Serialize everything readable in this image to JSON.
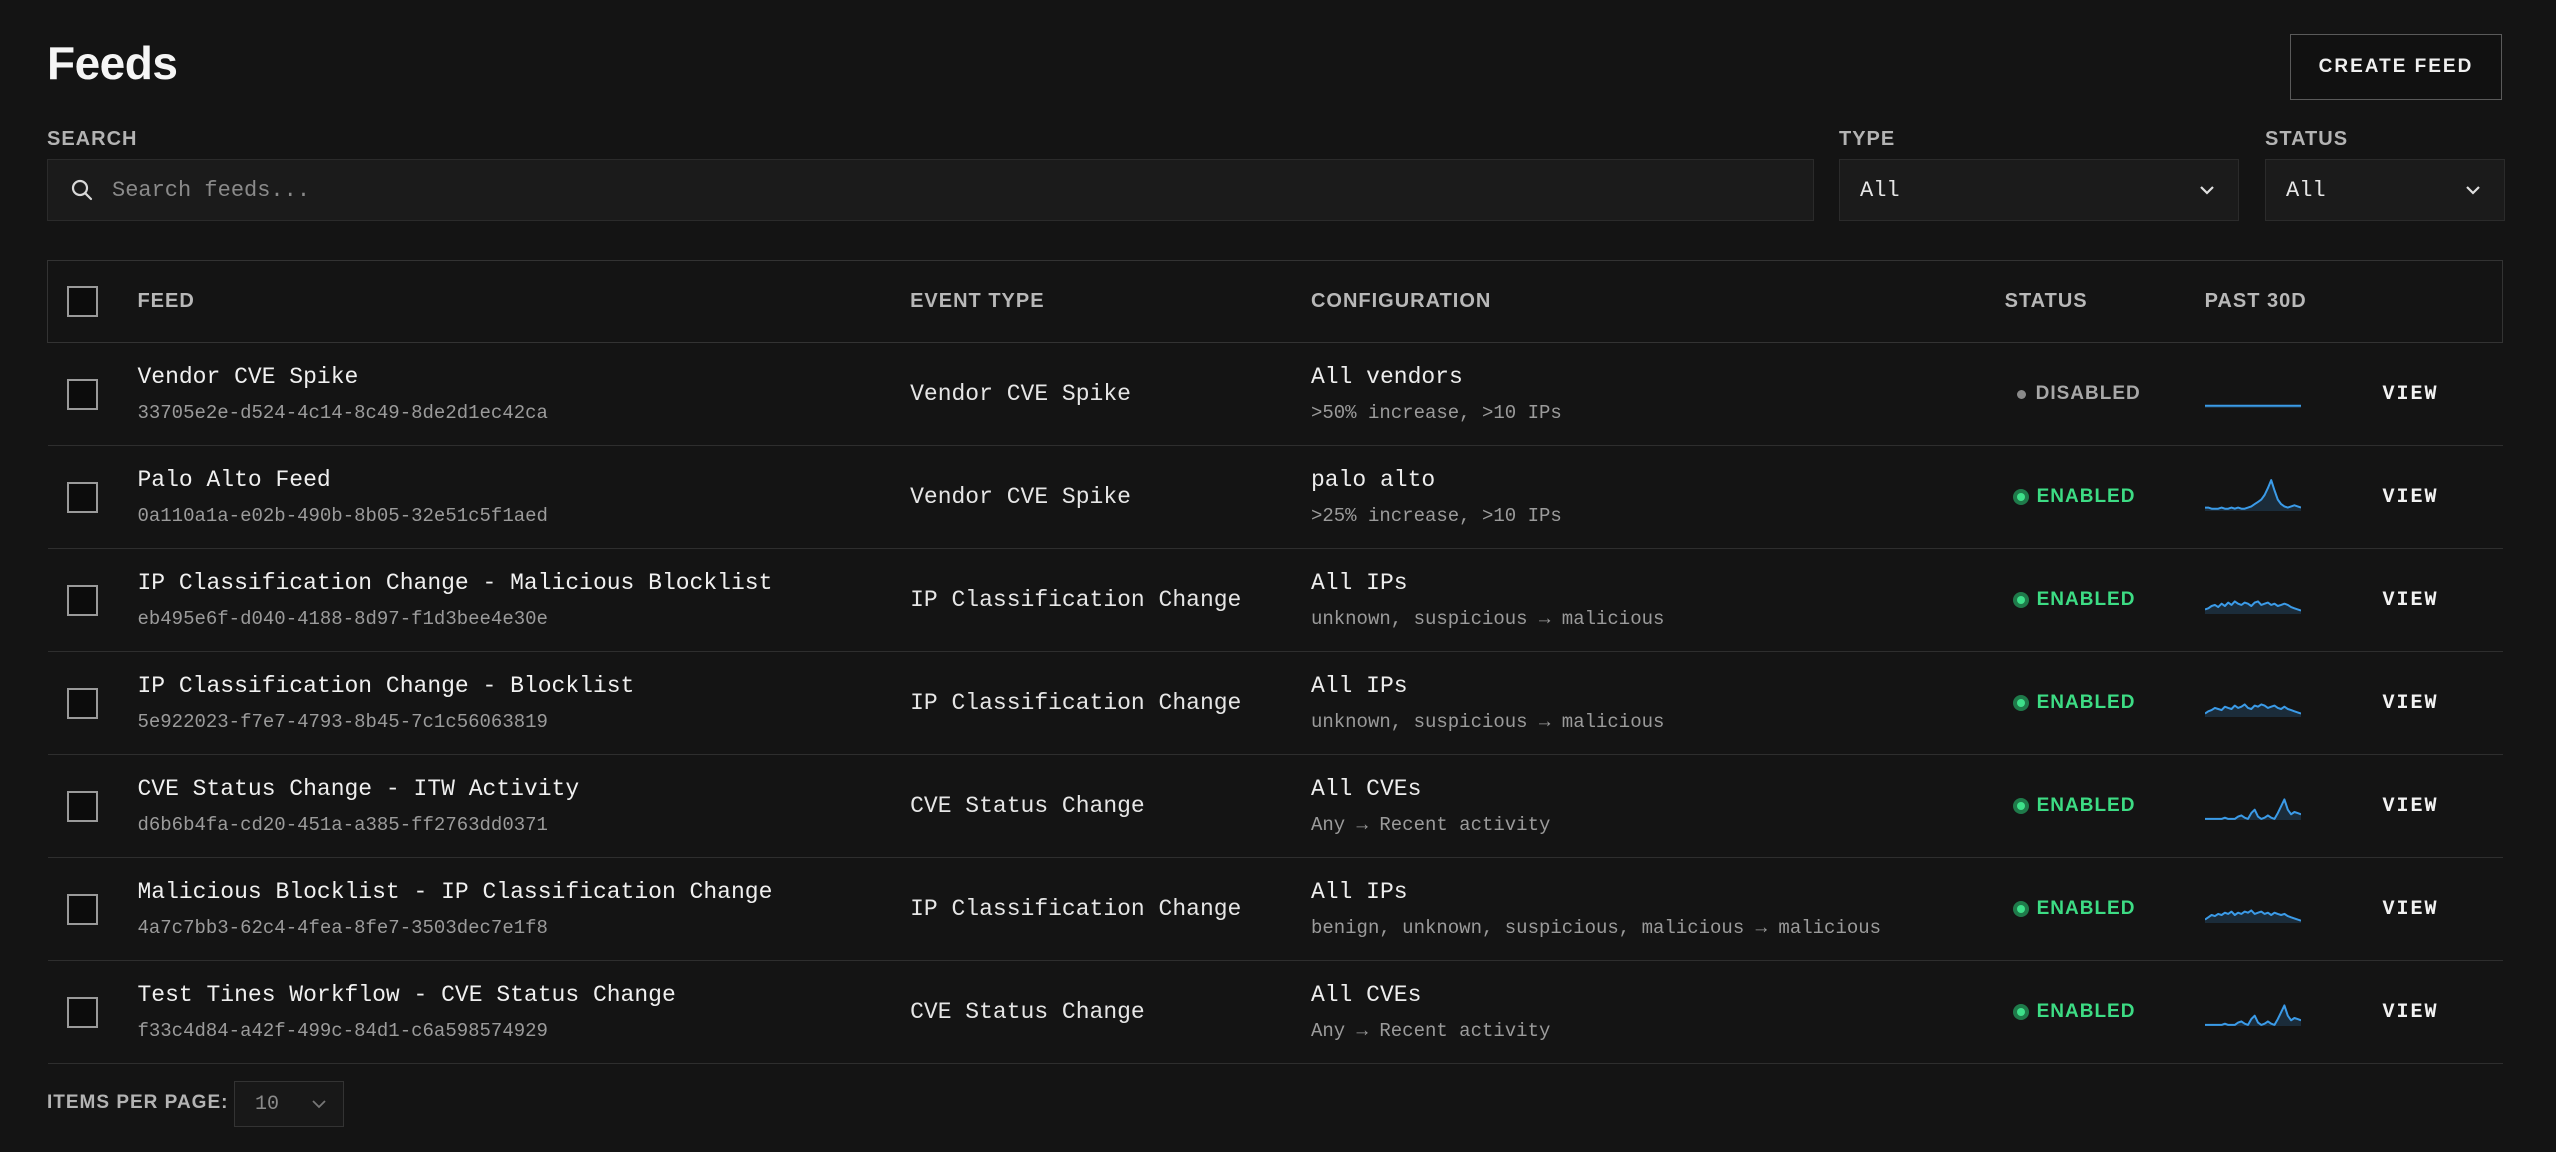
{
  "page": {
    "title": "Feeds",
    "create_label": "CREATE FEED"
  },
  "filters": {
    "search_label": "SEARCH",
    "search_placeholder": "Search feeds...",
    "type_label": "TYPE",
    "type_value": "All",
    "status_label": "STATUS",
    "status_value": "All"
  },
  "table": {
    "columns": [
      "FEED",
      "EVENT TYPE",
      "CONFIGURATION",
      "STATUS",
      "PAST 30D"
    ],
    "rows": [
      {
        "name": "Vendor CVE Spike",
        "id": "33705e2e-d524-4c14-8c49-8de2d1ec42ca",
        "event_type": "Vendor CVE Spike",
        "config_main": "All vendors",
        "config_sub": ">50% increase, >10 IPs",
        "status": "DISABLED",
        "action": "VIEW"
      },
      {
        "name": "Palo Alto Feed",
        "id": "0a110a1a-e02b-490b-8b05-32e51c5f1aed",
        "event_type": "Vendor CVE Spike",
        "config_main": "palo alto",
        "config_sub": ">25% increase, >10 IPs",
        "status": "ENABLED",
        "action": "VIEW"
      },
      {
        "name": "IP Classification Change - Malicious Blocklist",
        "id": "eb495e6f-d040-4188-8d97-f1d3bee4e30e",
        "event_type": "IP Classification Change",
        "config_main": "All IPs",
        "config_sub": "unknown, suspicious → malicious",
        "status": "ENABLED",
        "action": "VIEW"
      },
      {
        "name": "IP Classification Change - Blocklist",
        "id": "5e922023-f7e7-4793-8b45-7c1c56063819",
        "event_type": "IP Classification Change",
        "config_main": "All IPs",
        "config_sub": "unknown, suspicious → malicious",
        "status": "ENABLED",
        "action": "VIEW"
      },
      {
        "name": "CVE Status Change - ITW Activity",
        "id": "d6b6b4fa-cd20-451a-a385-ff2763dd0371",
        "event_type": "CVE Status Change",
        "config_main": "All CVEs",
        "config_sub": "Any → Recent activity",
        "status": "ENABLED",
        "action": "VIEW"
      },
      {
        "name": "Malicious Blocklist - IP Classification Change",
        "id": "4a7c7bb3-62c4-4fea-8fe7-3503dec7e1f8",
        "event_type": "IP Classification Change",
        "config_main": "All IPs",
        "config_sub": "benign, unknown, suspicious, malicious → malicious",
        "status": "ENABLED",
        "action": "VIEW"
      },
      {
        "name": "Test Tines Workflow - CVE Status Change",
        "id": "f33c4d84-a42f-499c-84d1-c6a598574929",
        "event_type": "CVE Status Change",
        "config_main": "All CVEs",
        "config_sub": "Any → Recent activity",
        "status": "ENABLED",
        "action": "VIEW"
      }
    ]
  },
  "sparklines": {
    "color": "#3b9be8",
    "series": [
      [
        2,
        2,
        2,
        2,
        2,
        2,
        2,
        2,
        2,
        2,
        2,
        2,
        2,
        2,
        2,
        2,
        2,
        2,
        2,
        2,
        2,
        2,
        2,
        2,
        2,
        2,
        2,
        2,
        2,
        2
      ],
      [
        3,
        3,
        2,
        2,
        2,
        3,
        2,
        2,
        3,
        2,
        3,
        2,
        2,
        3,
        4,
        6,
        8,
        10,
        14,
        20,
        27,
        18,
        10,
        6,
        4,
        3,
        4,
        5,
        4,
        3
      ],
      [
        4,
        5,
        7,
        8,
        6,
        9,
        7,
        10,
        8,
        11,
        9,
        8,
        10,
        9,
        7,
        10,
        11,
        8,
        9,
        10,
        8,
        9,
        7,
        8,
        9,
        8,
        6,
        5,
        4,
        3
      ],
      [
        3,
        5,
        6,
        8,
        7,
        6,
        9,
        8,
        7,
        10,
        8,
        9,
        11,
        8,
        7,
        10,
        9,
        11,
        10,
        8,
        9,
        10,
        8,
        7,
        9,
        7,
        6,
        5,
        4,
        3
      ],
      [
        1,
        1,
        1,
        1,
        1,
        1,
        2,
        1,
        1,
        1,
        3,
        4,
        2,
        1,
        6,
        9,
        3,
        1,
        2,
        4,
        2,
        1,
        6,
        12,
        18,
        9,
        5,
        7,
        6,
        5
      ],
      [
        3,
        5,
        7,
        6,
        8,
        7,
        9,
        8,
        10,
        7,
        9,
        8,
        10,
        9,
        11,
        8,
        9,
        10,
        8,
        9,
        7,
        9,
        8,
        7,
        8,
        6,
        5,
        4,
        3,
        2
      ],
      [
        1,
        1,
        1,
        1,
        1,
        1,
        2,
        1,
        1,
        1,
        3,
        4,
        2,
        1,
        6,
        9,
        3,
        1,
        2,
        4,
        2,
        1,
        6,
        12,
        18,
        9,
        5,
        7,
        6,
        5
      ]
    ]
  },
  "pagination": {
    "label": "ITEMS PER PAGE:",
    "value": "10"
  }
}
